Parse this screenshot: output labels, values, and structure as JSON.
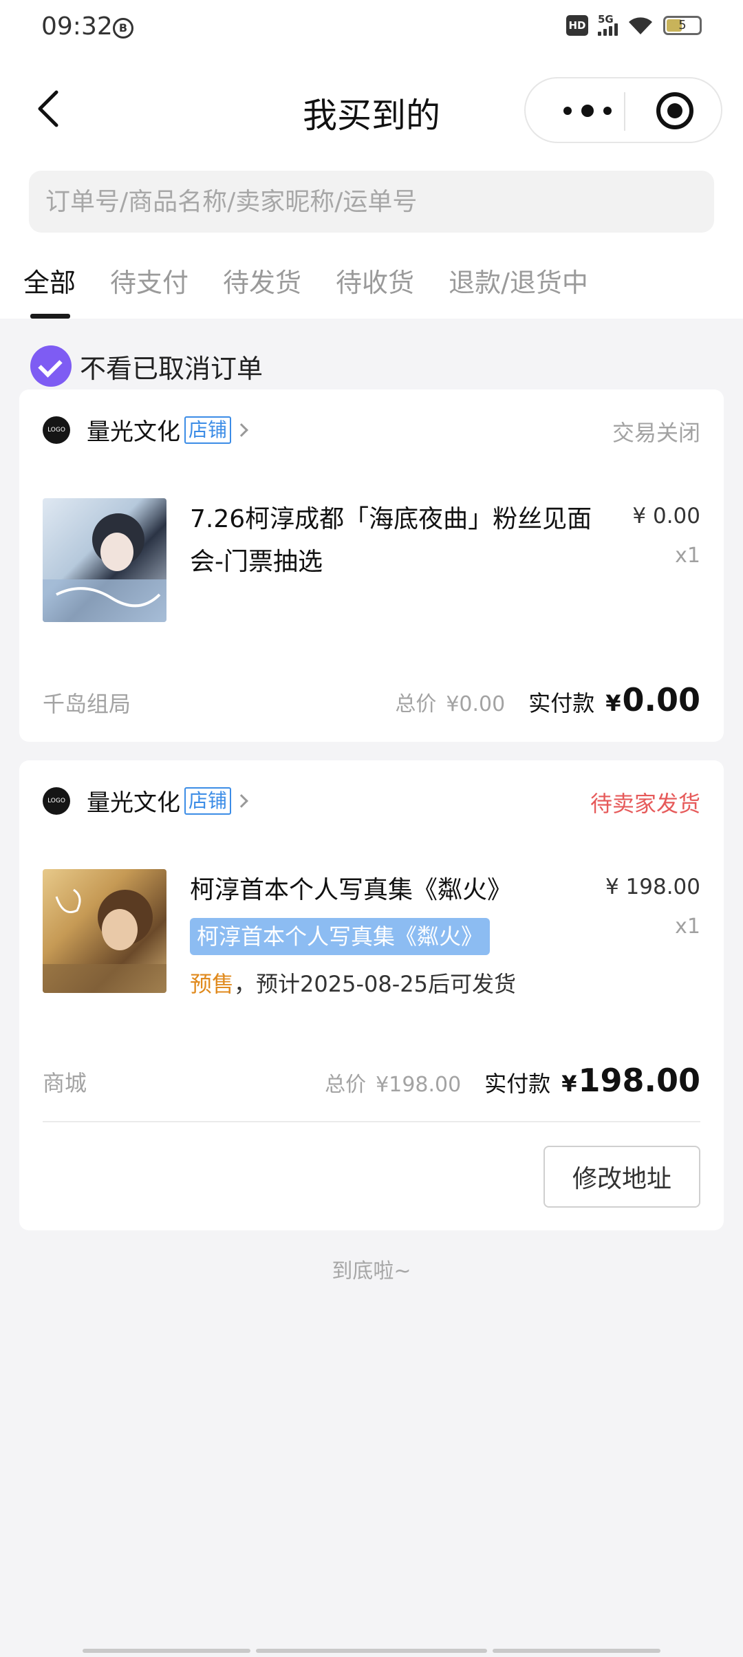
{
  "status_bar": {
    "time": "09:32",
    "circle_icon": "B",
    "hd": "HD",
    "network": "5G",
    "battery": "5"
  },
  "nav": {
    "title": "我买到的"
  },
  "search": {
    "placeholder": "订单号/商品名称/卖家昵称/运单号"
  },
  "tabs": [
    {
      "label": "全部",
      "active": true
    },
    {
      "label": "待支付"
    },
    {
      "label": "待发货"
    },
    {
      "label": "待收货"
    },
    {
      "label": "退款/退货中"
    }
  ],
  "filter": {
    "label": "不看已取消订单",
    "checked": true
  },
  "orders": [
    {
      "shop_name": "量光文化",
      "shop_badge": "店铺",
      "status": "交易关闭",
      "status_color": "#a3a3a3",
      "item_title": "7.26柯淳成都「海底夜曲」粉丝见面会-门票抽选",
      "price": "¥ 0.00",
      "qty": "x1",
      "source": "千岛组局",
      "total_label": "总价",
      "total_value": "¥0.00",
      "paid_label": "实付款",
      "paid_currency": "¥",
      "paid_value": "0.00"
    },
    {
      "shop_name": "量光文化",
      "shop_badge": "店铺",
      "status": "待卖家发货",
      "status_color": "#e65a5a",
      "item_title": "柯淳首本个人写真集《粼火》",
      "variant_tag": "柯淳首本个人写真集《粼火》",
      "presale_label": "预售",
      "presale_text": "，预计2025-08-25后可发货",
      "price": "¥ 198.00",
      "qty": "x1",
      "source": "商城",
      "total_label": "总价",
      "total_value": "¥198.00",
      "paid_label": "实付款",
      "paid_currency": "¥",
      "paid_value": "198.00",
      "action_button": "修改地址"
    }
  ],
  "footer": {
    "end_text": "到底啦~"
  }
}
